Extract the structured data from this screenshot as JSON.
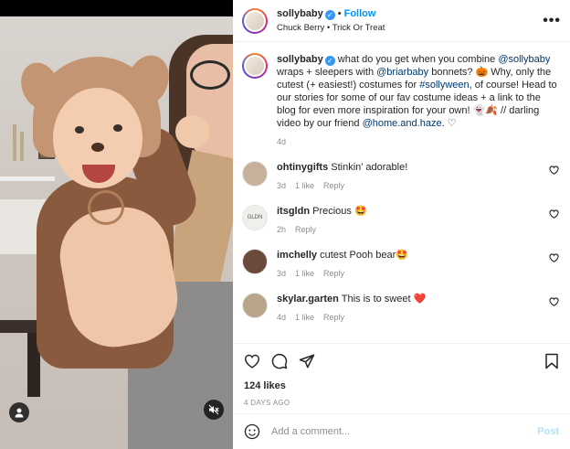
{
  "post": {
    "username": "sollybaby",
    "follow_label": "Follow",
    "audio": "Chuck Berry • Trick Or Treat",
    "more_label": "•••"
  },
  "caption": {
    "username": "sollybaby",
    "parts": [
      {
        "t": " what do you get when you combine ",
        "m": false
      },
      {
        "t": "@sollybaby",
        "m": true
      },
      {
        "t": " wraps + sleepers with ",
        "m": false
      },
      {
        "t": "@briarbaby",
        "m": true
      },
      {
        "t": " bonnets? 🎃 Why, only the cutest (+ easiest!) costumes for ",
        "m": false
      },
      {
        "t": "#sollyween",
        "m": true
      },
      {
        "t": ", of course! Head to our stories for some of our fav costume ideas + a link to the blog for even more inspiration for your own! 👻🍂 // darling video by our friend ",
        "m": false
      },
      {
        "t": "@home.and.haze",
        "m": true
      },
      {
        "t": ". ♡",
        "m": false
      }
    ],
    "time": "4d"
  },
  "comments": [
    {
      "user": "ohtinygifts",
      "text": "Stinkin’ adorable!",
      "time": "3d",
      "likes": "1 like",
      "reply": "Reply",
      "avatar_color": "#c7b19a"
    },
    {
      "user": "itsgldn",
      "text": "Precious 🤩",
      "time": "2h",
      "likes": "",
      "reply": "Reply",
      "avatar_color": "#f1efec",
      "avatar_text": "GLDN"
    },
    {
      "user": "imchelly",
      "text": "cutest Pooh bear🤩",
      "time": "3d",
      "likes": "1 like",
      "reply": "Reply",
      "avatar_color": "#6b4a3b"
    },
    {
      "user": "skylar.garten",
      "text": "This is to sweet ❤️",
      "time": "4d",
      "likes": "1 like",
      "reply": "Reply",
      "avatar_color": "#b9a48c"
    }
  ],
  "actions": {
    "likes": "124 likes",
    "ago": "4 DAYS AGO"
  },
  "add_comment": {
    "placeholder": "Add a comment...",
    "post_label": "Post"
  },
  "colors": {
    "accent": "#0095f6",
    "verified": "#3897f0",
    "post_disabled": "#b2dffc"
  }
}
